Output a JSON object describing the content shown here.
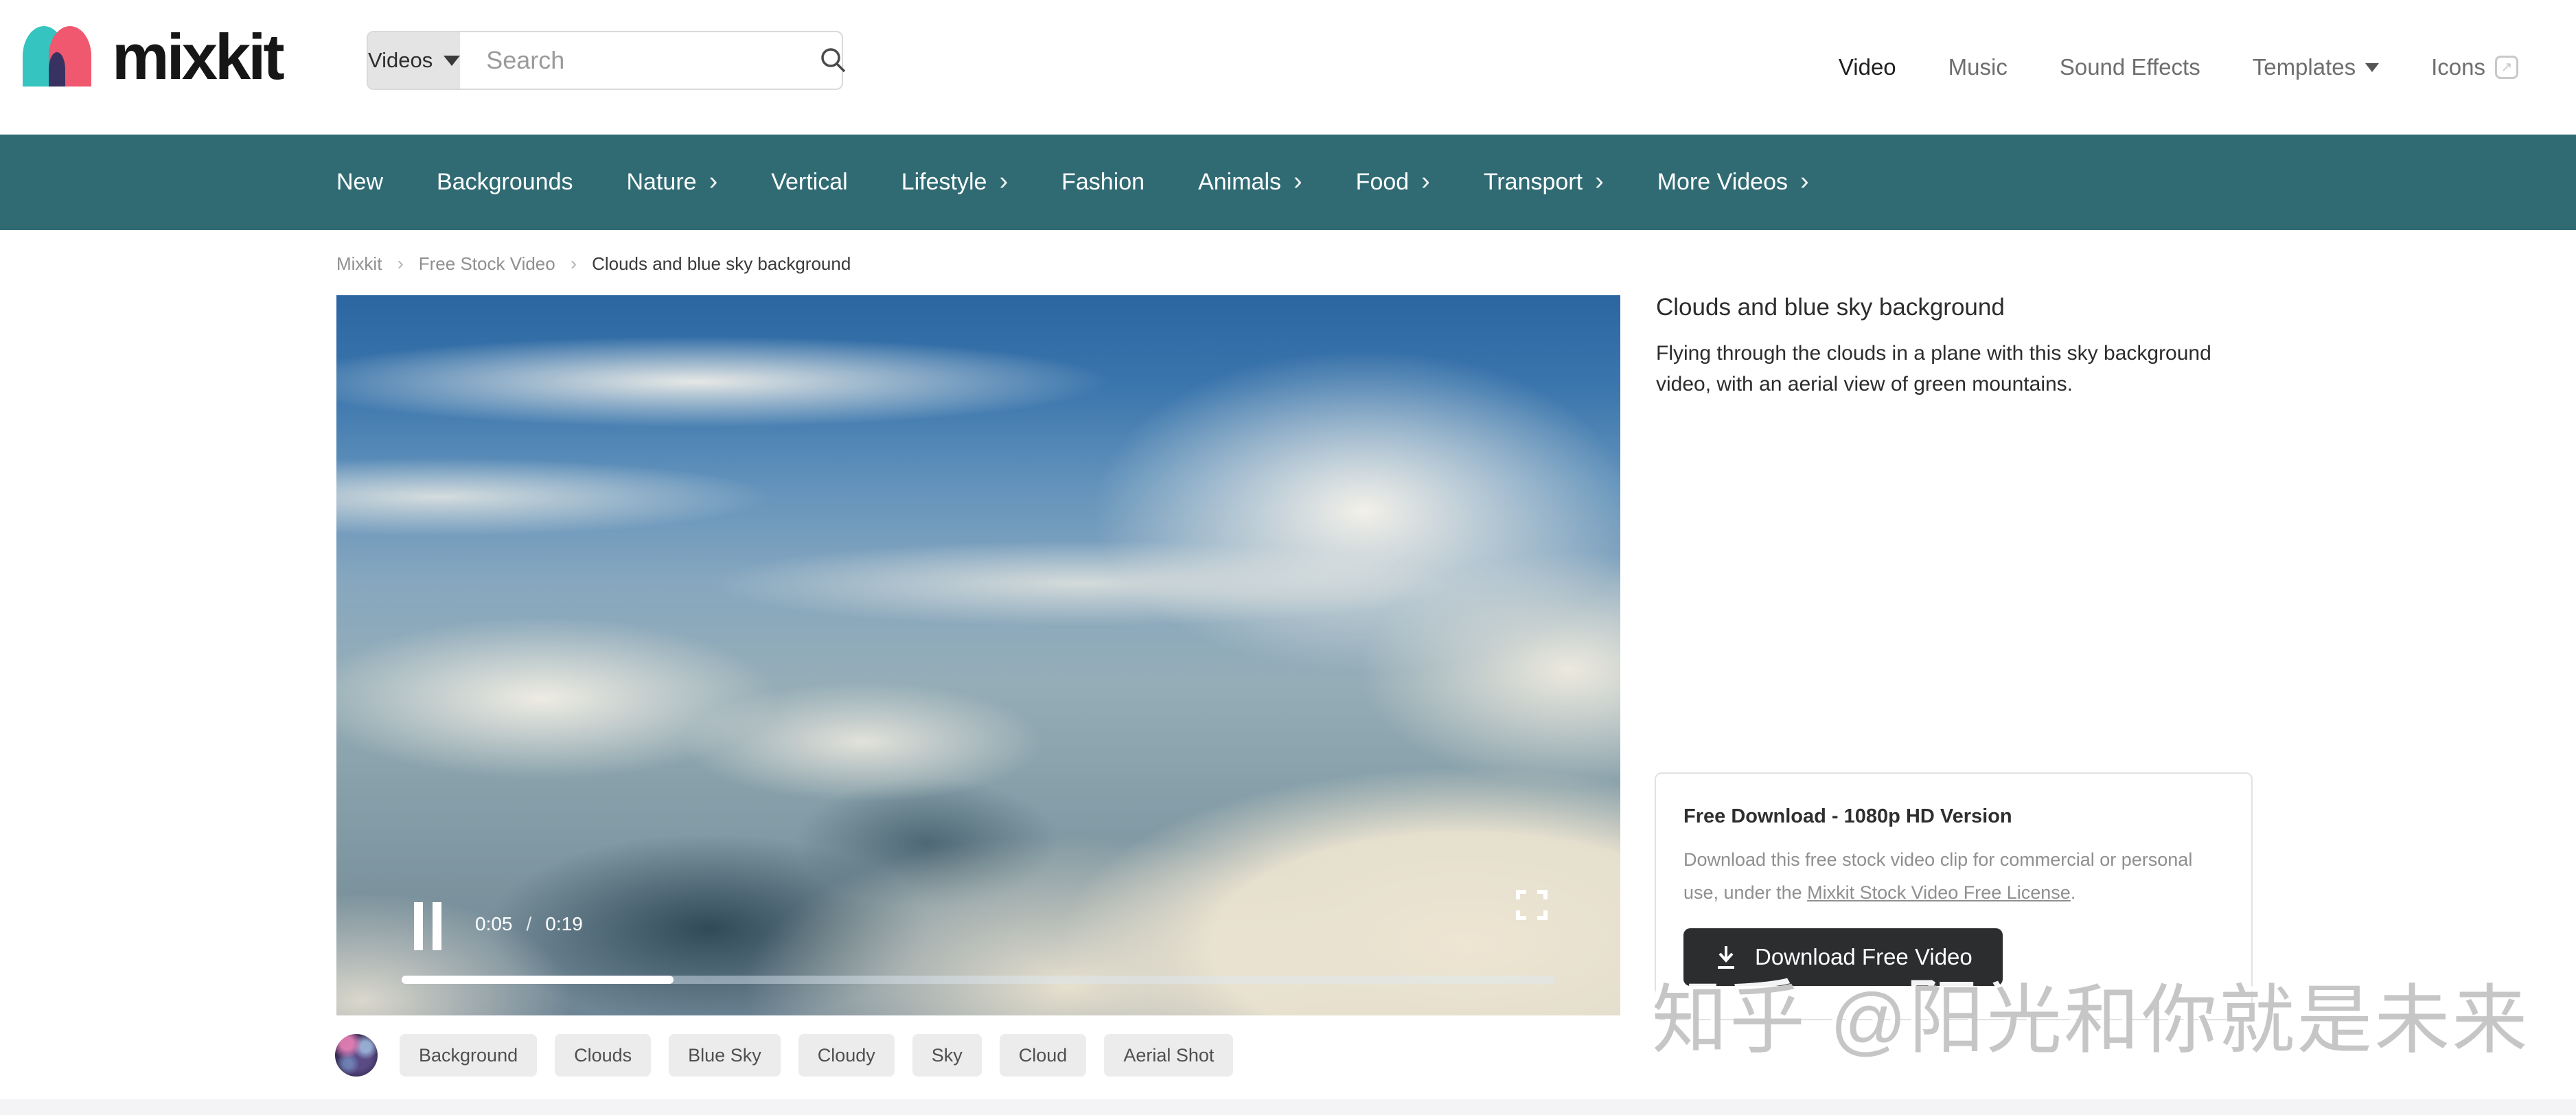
{
  "brand": {
    "logo_text": "mixkit"
  },
  "header": {
    "search": {
      "category": "Videos",
      "placeholder": "Search"
    },
    "nav": [
      {
        "label": "Video",
        "active": true
      },
      {
        "label": "Music",
        "active": false
      },
      {
        "label": "Sound Effects",
        "active": false
      },
      {
        "label": "Templates",
        "active": false,
        "has_dropdown": true
      },
      {
        "label": "Icons",
        "active": false,
        "external": true
      }
    ]
  },
  "category_nav": {
    "items": [
      {
        "label": "New",
        "has_children": false
      },
      {
        "label": "Backgrounds",
        "has_children": false
      },
      {
        "label": "Nature",
        "has_children": true
      },
      {
        "label": "Vertical",
        "has_children": false
      },
      {
        "label": "Lifestyle",
        "has_children": true
      },
      {
        "label": "Fashion",
        "has_children": false
      },
      {
        "label": "Animals",
        "has_children": true
      },
      {
        "label": "Food",
        "has_children": true
      },
      {
        "label": "Transport",
        "has_children": true
      },
      {
        "label": "More Videos",
        "has_children": true
      }
    ]
  },
  "breadcrumb": {
    "items": [
      "Mixkit",
      "Free Stock Video",
      "Clouds and blue sky background"
    ],
    "separator": "›"
  },
  "video": {
    "title": "Clouds and blue sky background",
    "description": "Flying through the clouds in a plane with this sky background video, with an aerial view of green mountains.",
    "player": {
      "state": "playing",
      "current_time": "0:05",
      "time_separator": "/",
      "duration": "0:19",
      "progress_percent": 23.6
    }
  },
  "download_card": {
    "title": "Free Download - 1080p HD Version",
    "body_before_link": "Download this free stock video clip for commercial or personal use, under the ",
    "license_link": "Mixkit Stock Video Free License",
    "body_after_link": ".",
    "button_label": "Download Free Video"
  },
  "tags": [
    "Background",
    "Clouds",
    "Blue Sky",
    "Cloudy",
    "Sky",
    "Cloud",
    "Aerial Shot"
  ],
  "watermark": "知乎 @阳光和你就是未来",
  "colors": {
    "category_nav_teal": "#306b74",
    "logo_teal": "#35c4bf",
    "logo_pink": "#f0586f",
    "logo_navy": "#383263",
    "download_button_dark": "#2b2d2e",
    "tag_bg": "#ececec",
    "bottom_strip": "#f4f4f6"
  }
}
